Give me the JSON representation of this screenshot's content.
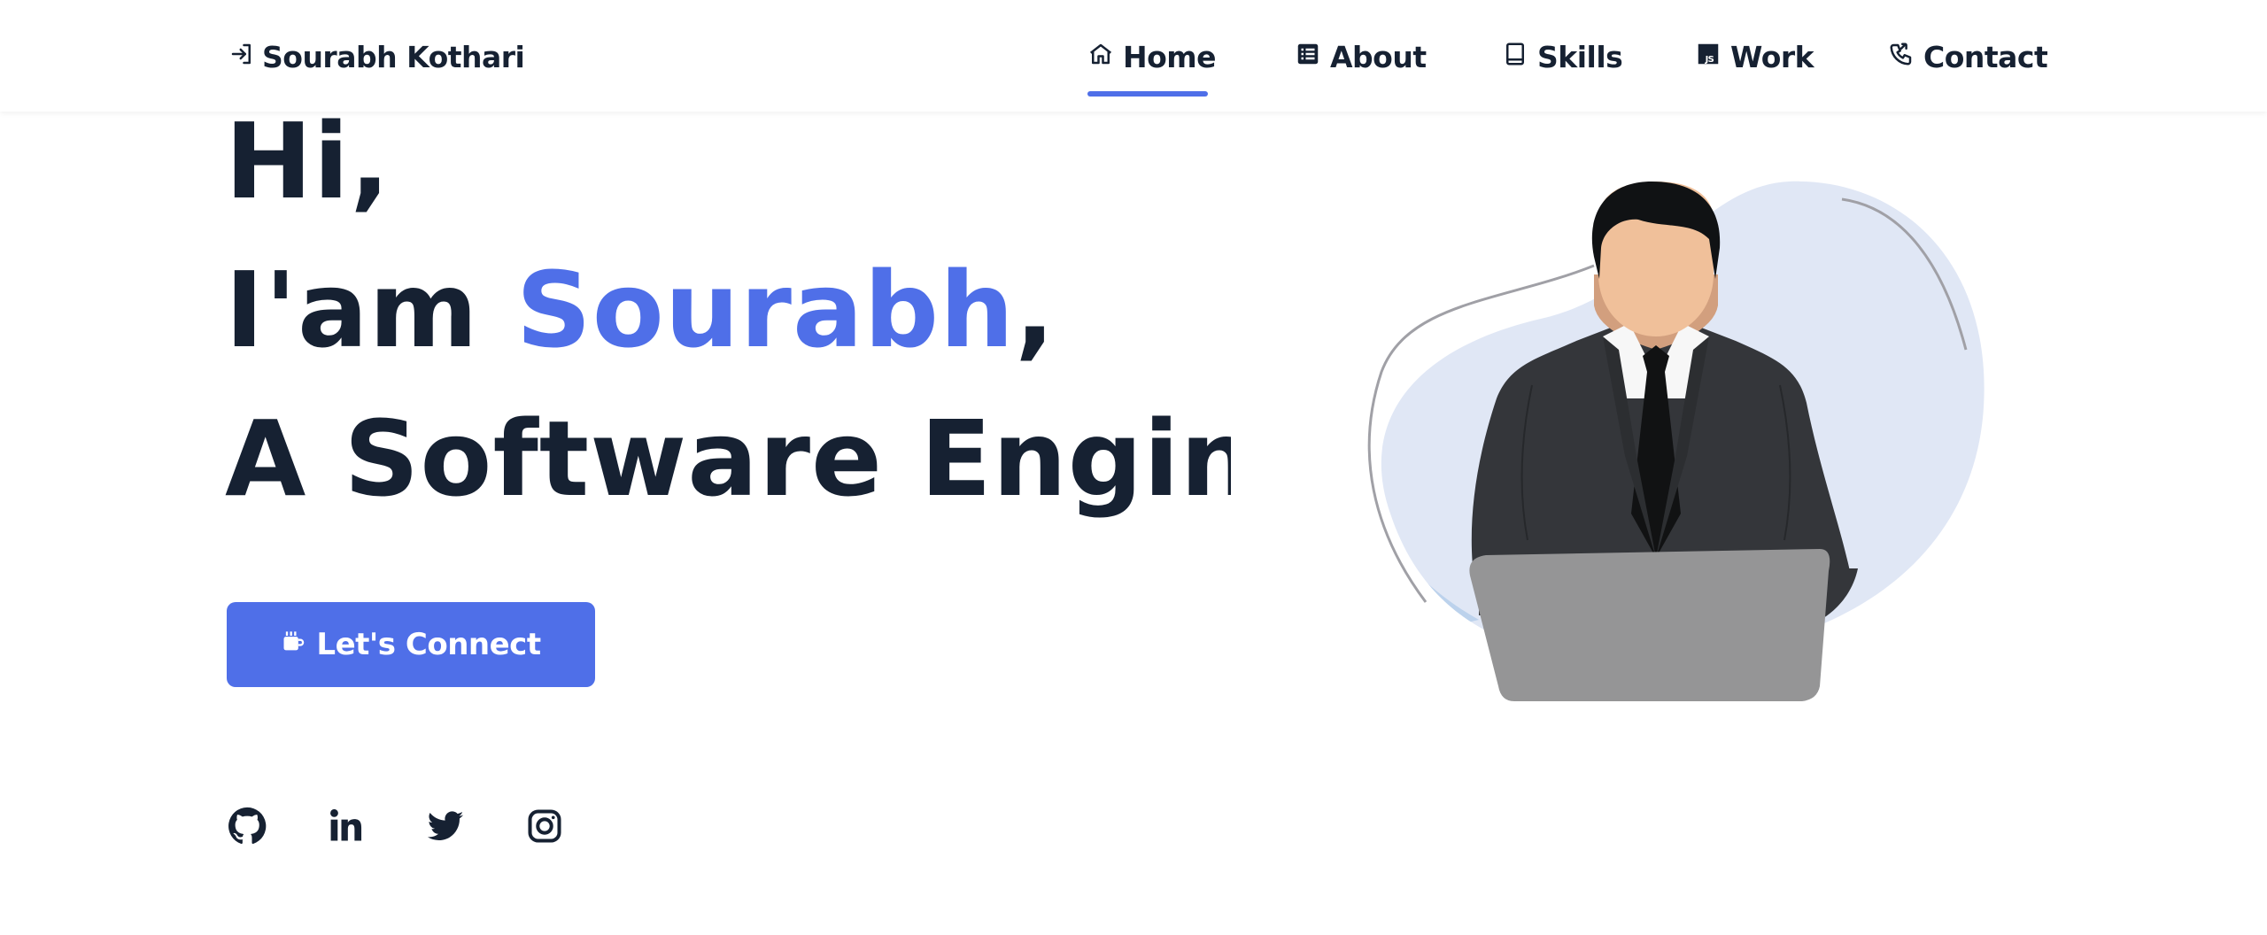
{
  "header": {
    "brand_name": "Sourabh Kothari",
    "brand_icon": "sign-in-icon",
    "nav": [
      {
        "label": "Home",
        "icon": "home-icon",
        "active": true
      },
      {
        "label": "About",
        "icon": "list-icon",
        "active": false
      },
      {
        "label": "Skills",
        "icon": "book-icon",
        "active": false
      },
      {
        "label": "Work",
        "icon": "js-icon",
        "active": false
      },
      {
        "label": "Contact",
        "icon": "phone-icon",
        "active": false
      }
    ]
  },
  "hero": {
    "greeting": "Hi,",
    "intro_prefix": "I'am ",
    "name": "Sourabh",
    "intro_suffix": ",",
    "role": "A Software Engineer",
    "cta_label": "Let's Connect",
    "cta_icon": "coffee-icon"
  },
  "socials": [
    {
      "name": "github",
      "icon": "github-icon"
    },
    {
      "name": "linkedin",
      "icon": "linkedin-icon"
    },
    {
      "name": "twitter",
      "icon": "twitter-icon"
    },
    {
      "name": "instagram",
      "icon": "instagram-icon"
    }
  ],
  "colors": {
    "accent": "#4f6fe8",
    "text": "#162132",
    "blob": "#e0e7f5",
    "suit": "#34363a",
    "laptop": "#959596"
  }
}
